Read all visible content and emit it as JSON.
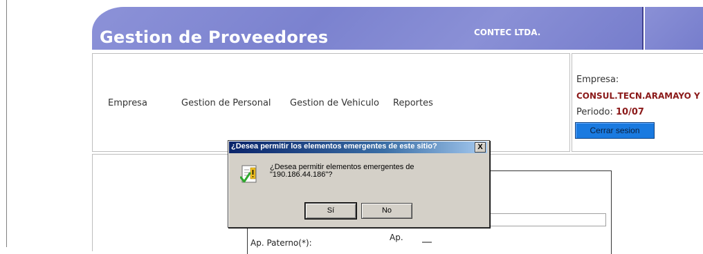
{
  "header": {
    "title": "Gestion de Proveedores",
    "company": "CONTEC LTDA."
  },
  "nav": {
    "items": [
      "Empresa",
      "Gestion de Personal",
      "Gestion de Vehiculo",
      "Reportes"
    ]
  },
  "info": {
    "company_label": "Empresa:",
    "company_name": "CONSUL.TECN.ARAMAYO Y AS",
    "period_label": "Periodo:",
    "period_value": "10/07",
    "logout_label": "Cerrar sesion"
  },
  "form": {
    "paterno_label": "Ap. Paterno(*):",
    "materno_label": "Ap."
  },
  "dialog": {
    "title": "¿Desea permitir los elementos emergentes de este sitio?",
    "close_label": "X",
    "message_line1": "¿Desea permitir elementos emergentes de",
    "message_line2": "\"190.186.44.186\"?",
    "yes_label": "Sí",
    "no_label": "No",
    "icon": "checklist-warning-icon"
  },
  "colors": {
    "banner": "#8088d4",
    "accent_red": "#8b1a1a",
    "logout_button": "#1a7ae0",
    "dialog_titlebar": "#0a246a"
  }
}
